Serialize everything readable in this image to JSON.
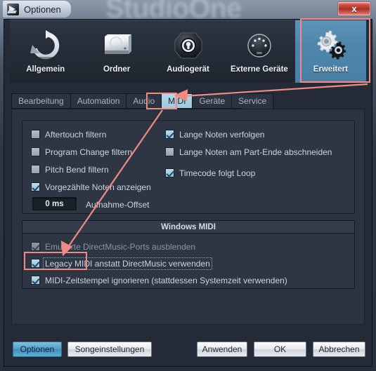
{
  "window": {
    "title": "Optionen",
    "brand_watermark": "StudioOne",
    "close_label": "x",
    "icon": "studio-one-logo-icon"
  },
  "categories": [
    {
      "label": "Allgemein",
      "icon": "refresh-circular-arrows-icon",
      "selected": false
    },
    {
      "label": "Ordner",
      "icon": "hard-drive-icon",
      "selected": false
    },
    {
      "label": "Audiogerät",
      "icon": "audio-interface-icon",
      "selected": false
    },
    {
      "label": "Externe Geräte",
      "icon": "midi-din-connector-icon",
      "selected": false
    },
    {
      "label": "Erweitert",
      "icon": "gears-icon",
      "selected": true
    }
  ],
  "tabs": [
    {
      "label": "Bearbeitung",
      "active": false
    },
    {
      "label": "Automation",
      "active": false
    },
    {
      "label": "Audio",
      "active": false
    },
    {
      "label": "MIDI",
      "active": true
    },
    {
      "label": "Geräte",
      "active": false
    },
    {
      "label": "Service",
      "active": false
    }
  ],
  "midi_panel": {
    "left_options": [
      {
        "label": "Aftertouch filtern",
        "checked": false,
        "disabled": false
      },
      {
        "label": "Program Change filtern",
        "checked": false,
        "disabled": false
      },
      {
        "label": "Pitch Bend filtern",
        "checked": false,
        "disabled": false
      },
      {
        "label": "Vorgezählte Noten anzeigen",
        "checked": true,
        "disabled": false
      }
    ],
    "right_options": [
      {
        "label": "Lange Noten verfolgen",
        "checked": true,
        "disabled": false
      },
      {
        "label": "Lange Noten am Part-Ende abschneiden",
        "checked": false,
        "disabled": false
      },
      {
        "label": "Timecode folgt Loop",
        "checked": true,
        "disabled": false
      }
    ],
    "record_offset": {
      "value": "0 ms",
      "label": "Aufnahme-Offset"
    }
  },
  "windows_midi": {
    "title": "Windows MIDI",
    "options": [
      {
        "label": "Emulierte DirectMusic-Ports ausblenden",
        "checked": true,
        "disabled": true,
        "focused": false
      },
      {
        "label": "Legacy MIDI anstatt DirectMusic verwenden",
        "checked": true,
        "disabled": false,
        "focused": true
      },
      {
        "label": "MIDI-Zeitstempel ignorieren (stattdessen Systemzeit verwenden)",
        "checked": true,
        "disabled": false,
        "focused": false
      }
    ]
  },
  "footer": {
    "left_buttons": [
      {
        "label": "Optionen",
        "primary": true
      },
      {
        "label": "Songeinstellungen",
        "primary": false
      }
    ],
    "right_buttons": [
      {
        "label": "Anwenden",
        "primary": false
      },
      {
        "label": "OK",
        "primary": false
      },
      {
        "label": "Abbrechen",
        "primary": false
      }
    ]
  },
  "annotations": {
    "color": "#ef8a85",
    "highlight_boxes": [
      "erweitert-category",
      "midi-tab",
      "legacy-midi-checkbox"
    ],
    "arrows": [
      {
        "from": "erweitert-category",
        "to": "midi-tab"
      },
      {
        "from": "midi-tab",
        "to": "legacy-midi-checkbox"
      }
    ]
  }
}
